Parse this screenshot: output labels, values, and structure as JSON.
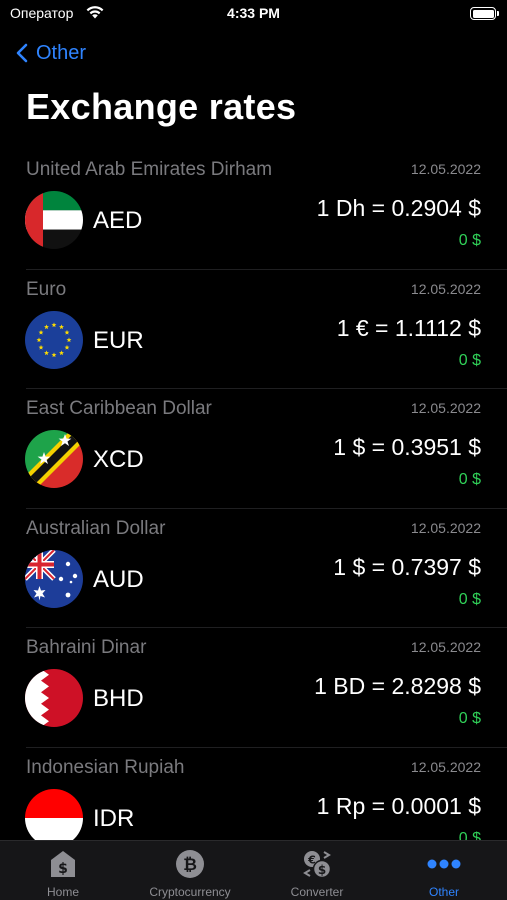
{
  "status_bar": {
    "carrier": "Оператор",
    "time": "4:33 PM"
  },
  "nav": {
    "back_label": "Other"
  },
  "page_title": "Exchange rates",
  "rates": [
    {
      "name": "United Arab Emirates Dirham",
      "date": "12.05.2022",
      "code": "AED",
      "value": "1 Dh = 0.2904 $",
      "change": "0 $",
      "flag": "uae-flag-icon"
    },
    {
      "name": "Euro",
      "date": "12.05.2022",
      "code": "EUR",
      "value": "1 € = 1.1112 $",
      "change": "0 $",
      "flag": "eu-flag-icon"
    },
    {
      "name": "East Caribbean Dollar",
      "date": "12.05.2022",
      "code": "XCD",
      "value": "1 $ = 0.3951 $",
      "change": "0 $",
      "flag": "saint-kitts-flag-icon"
    },
    {
      "name": "Australian Dollar",
      "date": "12.05.2022",
      "code": "AUD",
      "value": "1 $ = 0.7397 $",
      "change": "0 $",
      "flag": "australia-flag-icon"
    },
    {
      "name": "Bahraini Dinar",
      "date": "12.05.2022",
      "code": "BHD",
      "value": "1 BD = 2.8298 $",
      "change": "0 $",
      "flag": "bahrain-flag-icon"
    },
    {
      "name": "Indonesian Rupiah",
      "date": "12.05.2022",
      "code": "IDR",
      "value": "1 Rp = 0.0001 $",
      "change": "0 $",
      "flag": "indonesia-flag-icon"
    }
  ],
  "tabs": [
    {
      "label": "Home",
      "icon": "home-dollar-icon",
      "active": false
    },
    {
      "label": "Cryptocurrency",
      "icon": "bitcoin-icon",
      "active": false
    },
    {
      "label": "Converter",
      "icon": "converter-icon",
      "active": false
    },
    {
      "label": "Other",
      "icon": "more-dots-icon",
      "active": true
    }
  ],
  "colors": {
    "accent": "#2f84ff",
    "positive": "#30d158",
    "background": "#000000",
    "secondary_text": "#7a7a7e"
  }
}
